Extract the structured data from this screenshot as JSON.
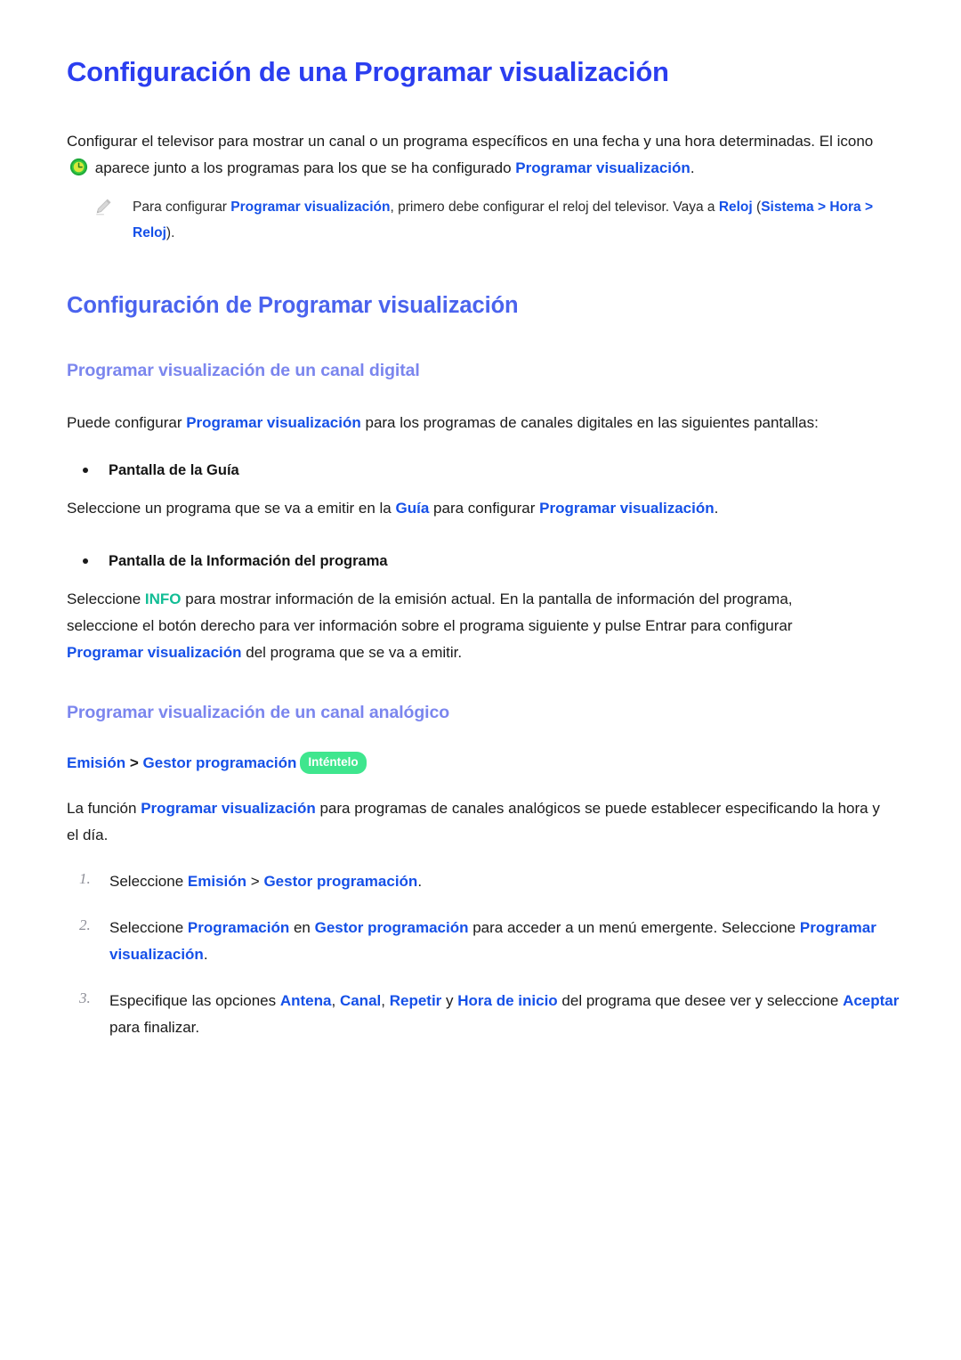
{
  "document": {
    "title": "Configuración de una Programar visualización",
    "intro": {
      "before_icon": "Configurar el televisor para mostrar un canal o un programa específicos en una fecha y una hora determinadas. El icono",
      "icon_name": "schedule-clock-icon",
      "after_icon_1": "aparece junto a los programas para los que se ha configurado",
      "keyword_1": "Programar visualización",
      "after_icon_2": "."
    },
    "note": {
      "icon_name": "pencil-note-icon",
      "part_1": "Para configurar",
      "kw_1": "Programar visualización",
      "part_2": ", primero debe configurar el reloj del televisor. Vaya a",
      "kw_2": "Reloj",
      "part_3": "(",
      "kw_3": "Sistema",
      "part_4": ">",
      "kw_4": "Hora",
      "part_5": ">",
      "kw_5": "Reloj",
      "part_6": ")."
    }
  },
  "section": {
    "heading": "Configuración de Programar visualización",
    "digital": {
      "heading": "Programar visualización de un canal digital",
      "intro_1": "Puede configurar",
      "intro_kw": "Programar visualización",
      "intro_2": "para los programas de canales digitales en las siguientes pantallas:",
      "bullets": [
        {
          "label": "Pantalla de la Guía",
          "body_1": "Seleccione un programa que se va a emitir en la",
          "kw_1": "Guía",
          "body_2": "para configurar",
          "kw_2": "Programar visualización",
          "body_3": "."
        },
        {
          "label": "Pantalla de la Información del programa",
          "body_1": "Seleccione",
          "kw_info": "INFO",
          "body_2": "para mostrar información de la emisión actual. En la pantalla de información del programa, seleccione el botón derecho para ver información sobre el programa siguiente y pulse Entrar para configurar",
          "kw_2": "Programar visualización",
          "body_3": "del programa que se va a emitir."
        }
      ]
    },
    "analog": {
      "heading": "Programar visualización de un canal analógico",
      "path": {
        "item_1": "Emisión",
        "separator": ">",
        "item_2": "Gestor programación",
        "badge": "Inténtelo"
      },
      "intro_1": "La función",
      "intro_kw": "Programar visualización",
      "intro_2": "para programas de canales analógicos se puede establecer especificando la hora y el día.",
      "steps": [
        {
          "marker": "1.",
          "t1": "Seleccione",
          "k1": "Emisión",
          "t2": ">",
          "k2": "Gestor programación",
          "t3": "."
        },
        {
          "marker": "2.",
          "t1": "Seleccione",
          "k1": "Programación",
          "t2": "en",
          "k2": "Gestor programación",
          "t3": "para acceder a un menú emergente. Seleccione",
          "k3": "Programar visualización",
          "t4": "."
        },
        {
          "marker": "3.",
          "t1": "Especifique las opciones",
          "k1": "Antena",
          "t2": ",",
          "k2": "Canal",
          "t3": ",",
          "k3": "Repetir",
          "t4": "y",
          "k4": "Hora de inicio",
          "t5": "del programa que desee ver y seleccione",
          "k5": "Aceptar",
          "t6": "para finalizar."
        }
      ]
    }
  },
  "colors": {
    "title_blue": "#2b3ef0",
    "section_blue": "#4a63ee",
    "subsection_blue": "#7b86ee",
    "keyword_blue": "#1550e8",
    "info_teal": "#12bd95",
    "badge_green": "#3fe68e",
    "page_background": "#ffffff"
  }
}
